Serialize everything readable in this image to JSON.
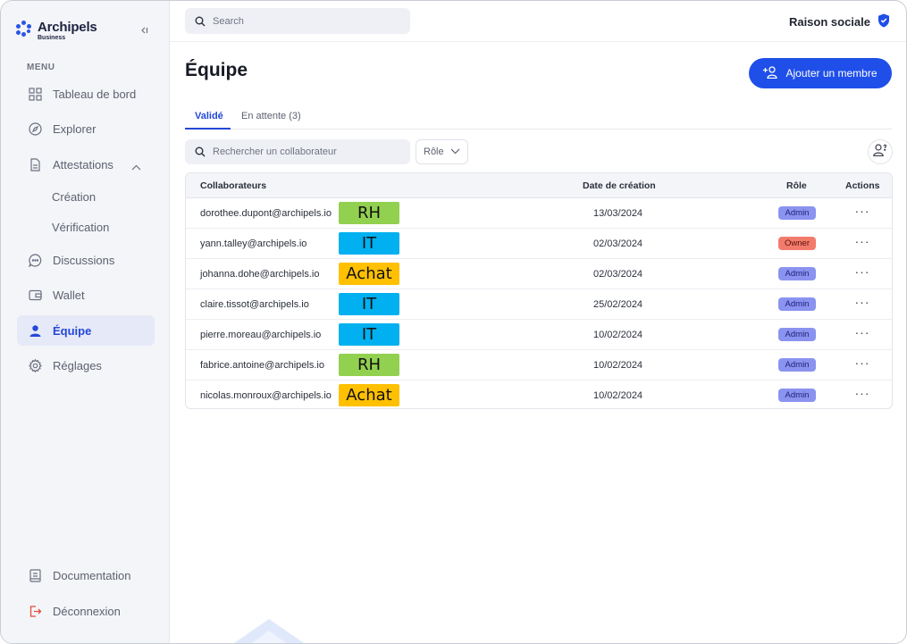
{
  "brand": {
    "name": "Archipels",
    "sub": "Business"
  },
  "sidebar": {
    "menu_caption": "MENU",
    "items": [
      {
        "label": "Tableau de bord",
        "icon": "grid-icon"
      },
      {
        "label": "Explorer",
        "icon": "compass-icon"
      },
      {
        "label": "Attestations",
        "icon": "document-icon"
      },
      {
        "label": "Discussions",
        "icon": "chat-icon"
      },
      {
        "label": "Wallet",
        "icon": "wallet-icon"
      },
      {
        "label": "Équipe",
        "icon": "user-icon"
      },
      {
        "label": "Réglages",
        "icon": "gear-icon"
      }
    ],
    "subitems": [
      "Création",
      "Vérification"
    ],
    "bottom": [
      {
        "label": "Documentation",
        "icon": "book-icon"
      },
      {
        "label": "Déconnexion",
        "icon": "logout-icon"
      }
    ]
  },
  "topbar": {
    "search_placeholder": "Search",
    "company": "Raison sociale"
  },
  "page": {
    "title": "Équipe",
    "add_button": "Ajouter un membre",
    "tabs": [
      "Validé",
      "En attente (3)"
    ],
    "search_placeholder": "Rechercher un collaborateur",
    "role_filter": "Rôle"
  },
  "table": {
    "headers": {
      "collab": "Collaborateurs",
      "date": "Date de création",
      "role": "Rôle",
      "actions": "Actions"
    },
    "rows": [
      {
        "email": "dorothee.dupont@archipels.io",
        "dept": "RH",
        "date": "13/03/2024",
        "role": "Admin",
        "actions": "···"
      },
      {
        "email": "yann.talley@archipels.io",
        "dept": "IT",
        "date": "02/03/2024",
        "role": "Owner",
        "actions": "···"
      },
      {
        "email": "johanna.dohe@archipels.io",
        "dept": "Achat",
        "date": "02/03/2024",
        "role": "Admin",
        "actions": "···"
      },
      {
        "email": "claire.tissot@archipels.io",
        "dept": "IT",
        "date": "25/02/2024",
        "role": "Admin",
        "actions": "···"
      },
      {
        "email": "pierre.moreau@archipels.io",
        "dept": "IT",
        "date": "10/02/2024",
        "role": "Admin",
        "actions": "···"
      },
      {
        "email": "fabrice.antoine@archipels.io",
        "dept": "RH",
        "date": "10/02/2024",
        "role": "Admin",
        "actions": "···"
      },
      {
        "email": "nicolas.monroux@archipels.io",
        "dept": "Achat",
        "date": "10/02/2024",
        "role": "Admin",
        "actions": "···"
      }
    ]
  },
  "colors": {
    "accent": "#1f4fe8",
    "dept_rh": "#92d050",
    "dept_it": "#00b0f0",
    "dept_achat": "#ffc000",
    "role_admin": "#8b93f0",
    "role_owner": "#f37b6c"
  }
}
